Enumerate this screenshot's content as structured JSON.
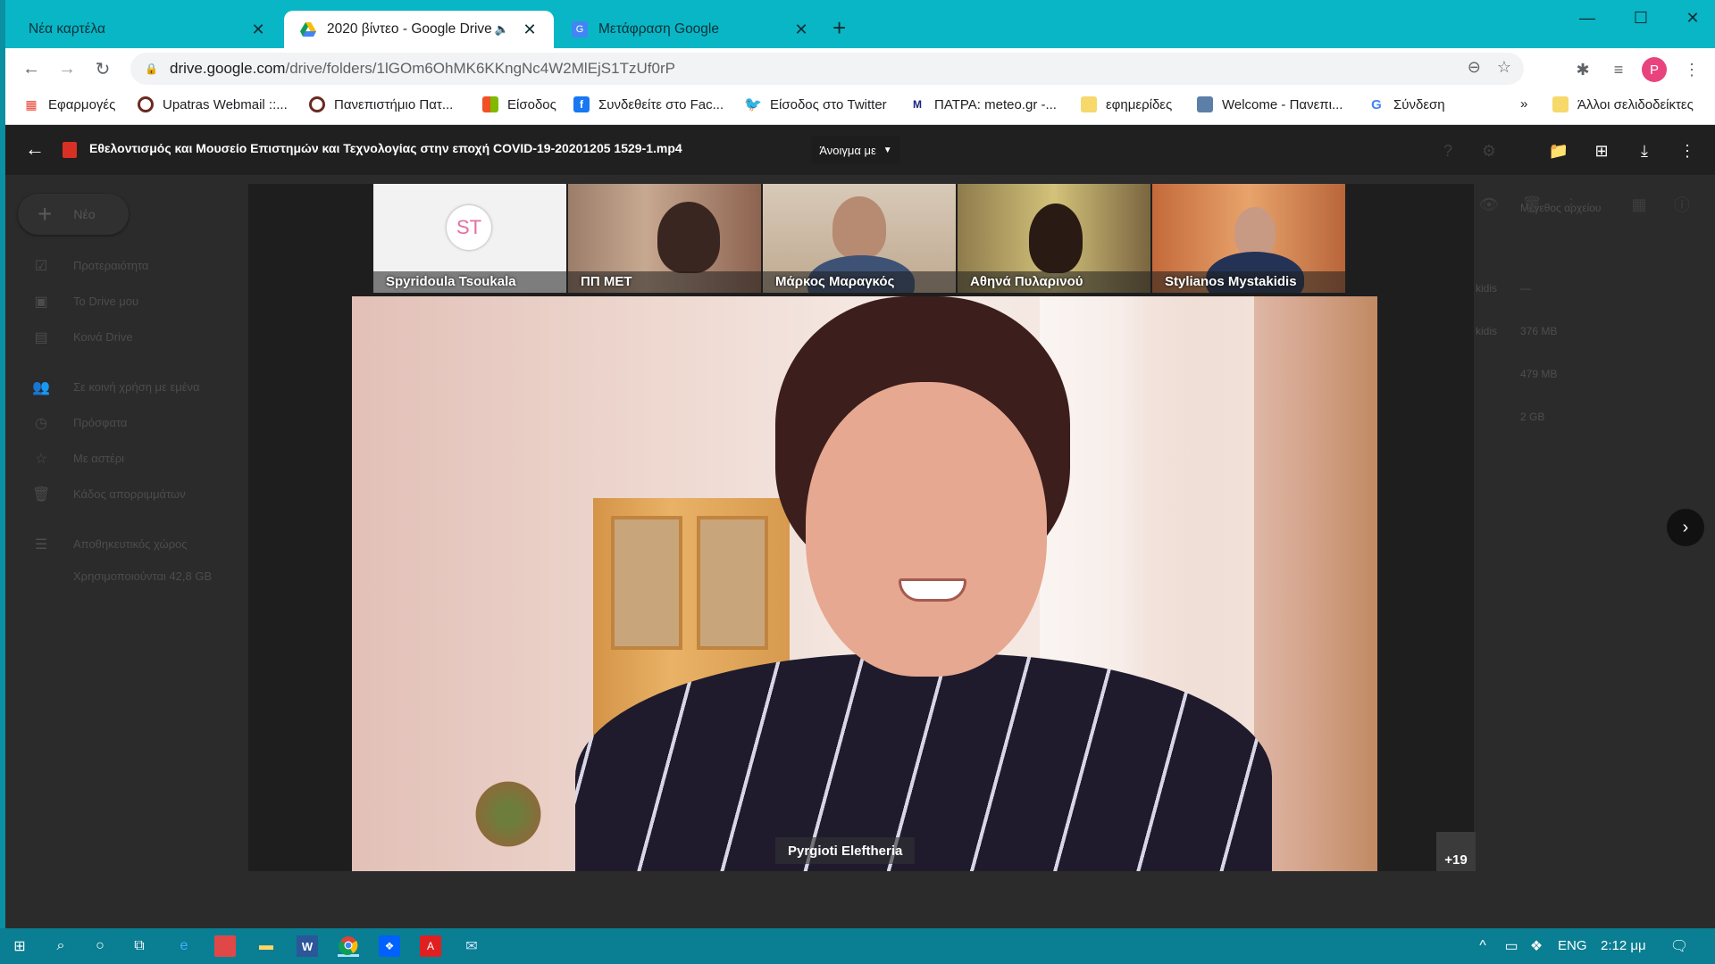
{
  "browser": {
    "tabs": [
      {
        "title": "Νέα καρτέλα",
        "active": false
      },
      {
        "title": "2020 βίντεο - Google Drive",
        "active": true
      },
      {
        "title": "Μετάφραση Google",
        "active": false
      }
    ],
    "url_host": "drive.google.com",
    "url_path": "/drive/folders/1lGOm6OhMK6KKngNc4W2MlEjS1TzUf0rP",
    "profile_initial": "P"
  },
  "bookmarks": [
    {
      "label": "Εφαρμογές",
      "icon": "apps-grid-icon"
    },
    {
      "label": "Upatras Webmail ::...",
      "icon": "upatras-icon"
    },
    {
      "label": "Πανεπιστήμιο Πατ...",
      "icon": "upatras-icon"
    },
    {
      "label": "Είσοδος",
      "icon": "windows-icon"
    },
    {
      "label": "Συνδεθείτε στο Fac...",
      "icon": "facebook-icon"
    },
    {
      "label": "Είσοδος στο Twitter",
      "icon": "twitter-icon"
    },
    {
      "label": "ΠΑΤΡΑ: meteo.gr -...",
      "icon": "meteo-icon"
    },
    {
      "label": "εφημερίδες",
      "icon": "folder-icon"
    },
    {
      "label": "Welcome - Πανεπι...",
      "icon": "site-icon"
    },
    {
      "label": "Σύνδεση",
      "icon": "google-icon"
    },
    {
      "label": "Άλλοι σελιδοδείκτες",
      "icon": "folder-icon"
    }
  ],
  "drive": {
    "new_label": "Νέο",
    "sidebar": [
      "Προτεραιότητα",
      "Το Drive μου",
      "Κοινά Drive",
      "Σε κοινή χρήση με εμένα",
      "Πρόσφατα",
      "Με αστέρι",
      "Κάδος απορριμμάτων",
      "Αποθηκευτικός χώρος"
    ],
    "storage_used": "Χρησιμοποιούνται 42,8 GB",
    "col_header": "Μέγεθος αρχείου",
    "rows": [
      {
        "owner": "kidis",
        "size": "—"
      },
      {
        "owner": "kidis",
        "size": "376 MB"
      },
      {
        "owner": "",
        "size": "479 MB"
      },
      {
        "owner": "",
        "size": "2 GB"
      }
    ]
  },
  "viewer": {
    "file_title": "Εθελοντισμός και Μουσείο Επιστημών και Τεχνολογίας στην εποχή COVID-19-20201205 1529-1.mp4",
    "open_with": "Άνοιγμα με"
  },
  "video": {
    "participants": [
      {
        "name": "Spyridoula Tsoukala",
        "initials": "ST"
      },
      {
        "name": "ΠΠ ΜΕΤ"
      },
      {
        "name": "Μάρκος Μαραγκός"
      },
      {
        "name": "Αθηνά Πυλαρινού"
      },
      {
        "name": "Stylianos Mystakidis"
      }
    ],
    "speaker": "Pyrgioti Eleftheria",
    "more_count": "+19"
  },
  "taskbar": {
    "language": "ENG",
    "time": "2:12 μμ"
  },
  "colors": {
    "tabstrip": "#09b6c5",
    "taskbar": "#0a7e92",
    "profile": "#e8437d"
  }
}
